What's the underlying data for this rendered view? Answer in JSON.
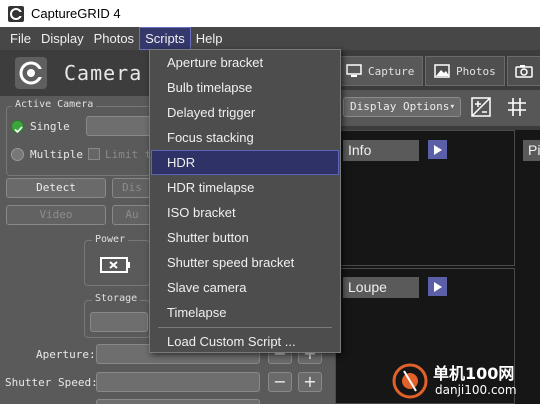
{
  "app": {
    "title": "CaptureGRID 4"
  },
  "menubar": [
    "File",
    "Display",
    "Photos",
    "Scripts",
    "Help"
  ],
  "camera_panel": {
    "title": "Camera",
    "active_camera": {
      "title": "Active Camera",
      "single": "Single",
      "multiple": "Multiple",
      "limit": "Limit t"
    },
    "buttons": {
      "detect": "Detect",
      "dis": "Dis",
      "video": "Video",
      "au": "Au"
    },
    "power": "Power",
    "storage": "Storage",
    "aperture": "Aperture:",
    "shutter_speed": "Shutter Speed:",
    "minus": "−",
    "plus": "+"
  },
  "tabs": [
    {
      "label": "Capture",
      "icon": "monitor-icon"
    },
    {
      "label": "Photos",
      "icon": "photo-icon"
    },
    {
      "label": "",
      "icon": "camera-icon"
    }
  ],
  "display_options": "Display Options",
  "grid": {
    "info": "Info",
    "loupe": "Loupe",
    "pi": "Pi"
  },
  "scripts_menu": {
    "items": [
      "Aperture bracket",
      "Bulb timelapse",
      "Delayed trigger",
      "Focus stacking",
      "HDR",
      "HDR timelapse",
      "ISO bracket",
      "Shutter button",
      "Shutter speed bracket",
      "Slave camera",
      "Timelapse"
    ],
    "custom": "Load Custom Script ...",
    "highlighted": "HDR"
  },
  "watermark": {
    "text": "单机100网",
    "url": "danji100.com"
  },
  "colors": {
    "accent": "#5b5fa8",
    "highlight": "#2f3266",
    "menu_bg": "#4d4d4d"
  }
}
